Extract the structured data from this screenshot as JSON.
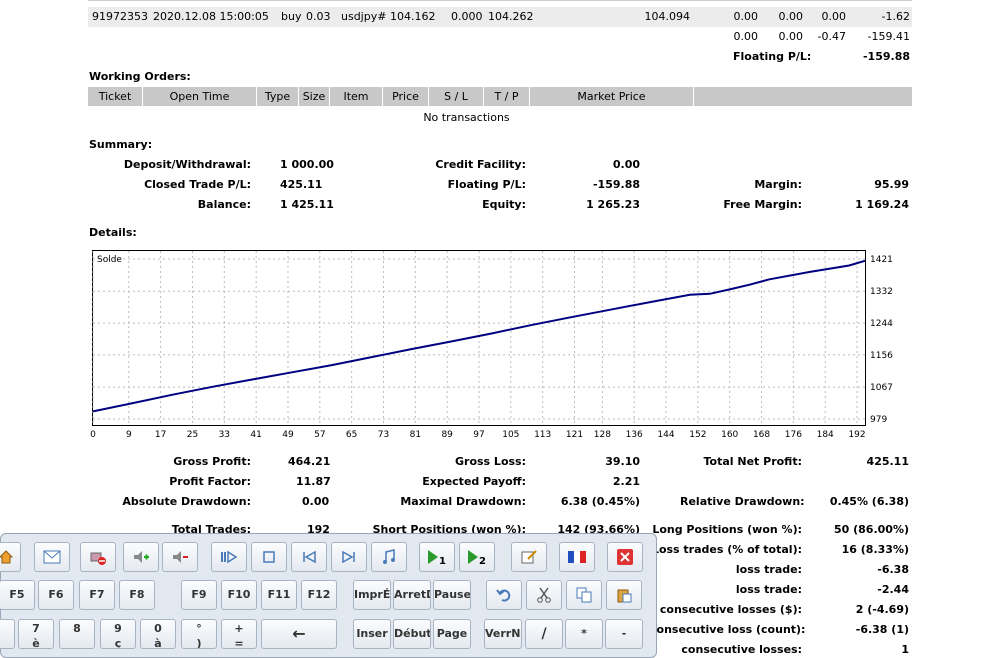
{
  "trade_row": {
    "ticket": "91972353",
    "open_time": "2020.12.08 15:00:05",
    "type": "buy",
    "size": "0.03",
    "item": "usdjpy#",
    "price": "104.162",
    "sl": "0.000",
    "tp": "104.262",
    "market_price": "104.094",
    "commission": "0.00",
    "taxes": "0.00",
    "swap": "0.00",
    "profit": "-1.62"
  },
  "totals_row": {
    "commission": "0.00",
    "taxes": "0.00",
    "swap": "-0.47",
    "profit": "-159.41"
  },
  "floating": {
    "label": "Floating P/L:",
    "value": "-159.88"
  },
  "working_orders": {
    "title": "Working Orders:",
    "headers": [
      "Ticket",
      "Open Time",
      "Type",
      "Size",
      "Item",
      "Price",
      "S / L",
      "T / P",
      "Market Price"
    ],
    "empty": "No transactions"
  },
  "summary": {
    "title": "Summary:",
    "deposit_label": "Deposit/Withdrawal:",
    "deposit": "1 000.00",
    "closed_label": "Closed Trade P/L:",
    "closed": "425.11",
    "balance_label": "Balance:",
    "balance": "1 425.11",
    "credit_label": "Credit Facility:",
    "credit": "0.00",
    "floating_label": "Floating P/L:",
    "floating": "-159.88",
    "equity_label": "Equity:",
    "equity": "1 265.23",
    "margin_label": "Margin:",
    "margin": "95.99",
    "free_margin_label": "Free Margin:",
    "free_margin": "1 169.24"
  },
  "details": {
    "title": "Details:"
  },
  "chart_data": {
    "type": "line",
    "title": "Solde",
    "x_ticks": [
      "0",
      "9",
      "17",
      "25",
      "33",
      "41",
      "49",
      "57",
      "65",
      "73",
      "81",
      "89",
      "97",
      "105",
      "113",
      "121",
      "128",
      "136",
      "144",
      "152",
      "160",
      "168",
      "176",
      "184",
      "192"
    ],
    "y_ticks": [
      "1421",
      "1332",
      "1244",
      "1156",
      "1067",
      "979"
    ],
    "xlim": [
      0,
      194
    ],
    "ylim": [
      979,
      1421
    ],
    "grid": true,
    "series": [
      {
        "color": "#000080",
        "x": [
          0,
          10,
          20,
          30,
          40,
          50,
          60,
          70,
          80,
          90,
          100,
          110,
          120,
          130,
          140,
          150,
          155,
          160,
          165,
          170,
          180,
          190,
          194
        ],
        "y": [
          1000,
          1023,
          1046,
          1068,
          1088,
          1108,
          1128,
          1150,
          1172,
          1193,
          1215,
          1238,
          1260,
          1281,
          1302,
          1322,
          1325,
          1337,
          1350,
          1365,
          1385,
          1403,
          1416
        ]
      }
    ]
  },
  "stats": {
    "gross_profit_label": "Gross Profit:",
    "gross_profit": "464.21",
    "gross_loss_label": "Gross Loss:",
    "gross_loss": "39.10",
    "net_profit_label": "Total Net Profit:",
    "net_profit": "425.11",
    "profit_factor_label": "Profit Factor:",
    "profit_factor": "11.87",
    "expected_payoff_label": "Expected Payoff:",
    "expected_payoff": "2.21",
    "abs_dd_label": "Absolute Drawdown:",
    "abs_dd": "0.00",
    "max_dd_label": "Maximal Drawdown:",
    "max_dd": "6.38 (0.45%)",
    "rel_dd_label": "Relative Drawdown:",
    "rel_dd": "0.45% (6.38)",
    "total_trades_label": "Total Trades:",
    "total_trades": "192",
    "short_label": "Short Positions (won %):",
    "short": "142 (93.66%)",
    "long_label": "Long Positions (won %):",
    "long": "50 (86.00%)",
    "loss_trades_label": "Loss trades (% of total):",
    "loss_trades": "16 (8.33%)",
    "loss_trade_1_label": "loss trade:",
    "loss_trade_1": "-6.38",
    "loss_trade_2_label": "loss trade:",
    "loss_trade_2": "-2.44",
    "consec_losses_usd_label": "consecutive losses ($):",
    "consec_losses_usd": "2 (-4.69)",
    "consec_loss_count_label": "consecutive loss (count):",
    "consec_loss_count": "-6.38 (1)",
    "consec_losses_label": "consecutive losses:",
    "consec_losses": "1"
  },
  "keyboard": {
    "fkeys": [
      "F5",
      "F6",
      "F7",
      "F8",
      "F9",
      "F10",
      "F11",
      "F12"
    ],
    "special": [
      "ImprÉ",
      "ArretD",
      "Pause"
    ],
    "num_row": [
      {
        "top": "7",
        "bottom": "è"
      },
      {
        "top": "8",
        "bottom": "_"
      },
      {
        "top": "9",
        "bottom": "ç"
      },
      {
        "top": "0",
        "bottom": "à"
      },
      {
        "top": "°",
        "bottom": ")"
      },
      {
        "top": "+",
        "bottom": "="
      }
    ],
    "backspace": "←",
    "nav": [
      "Inser",
      "Début",
      "Page F",
      "VerrNu"
    ],
    "numpad": [
      "/",
      "*",
      "-"
    ]
  }
}
